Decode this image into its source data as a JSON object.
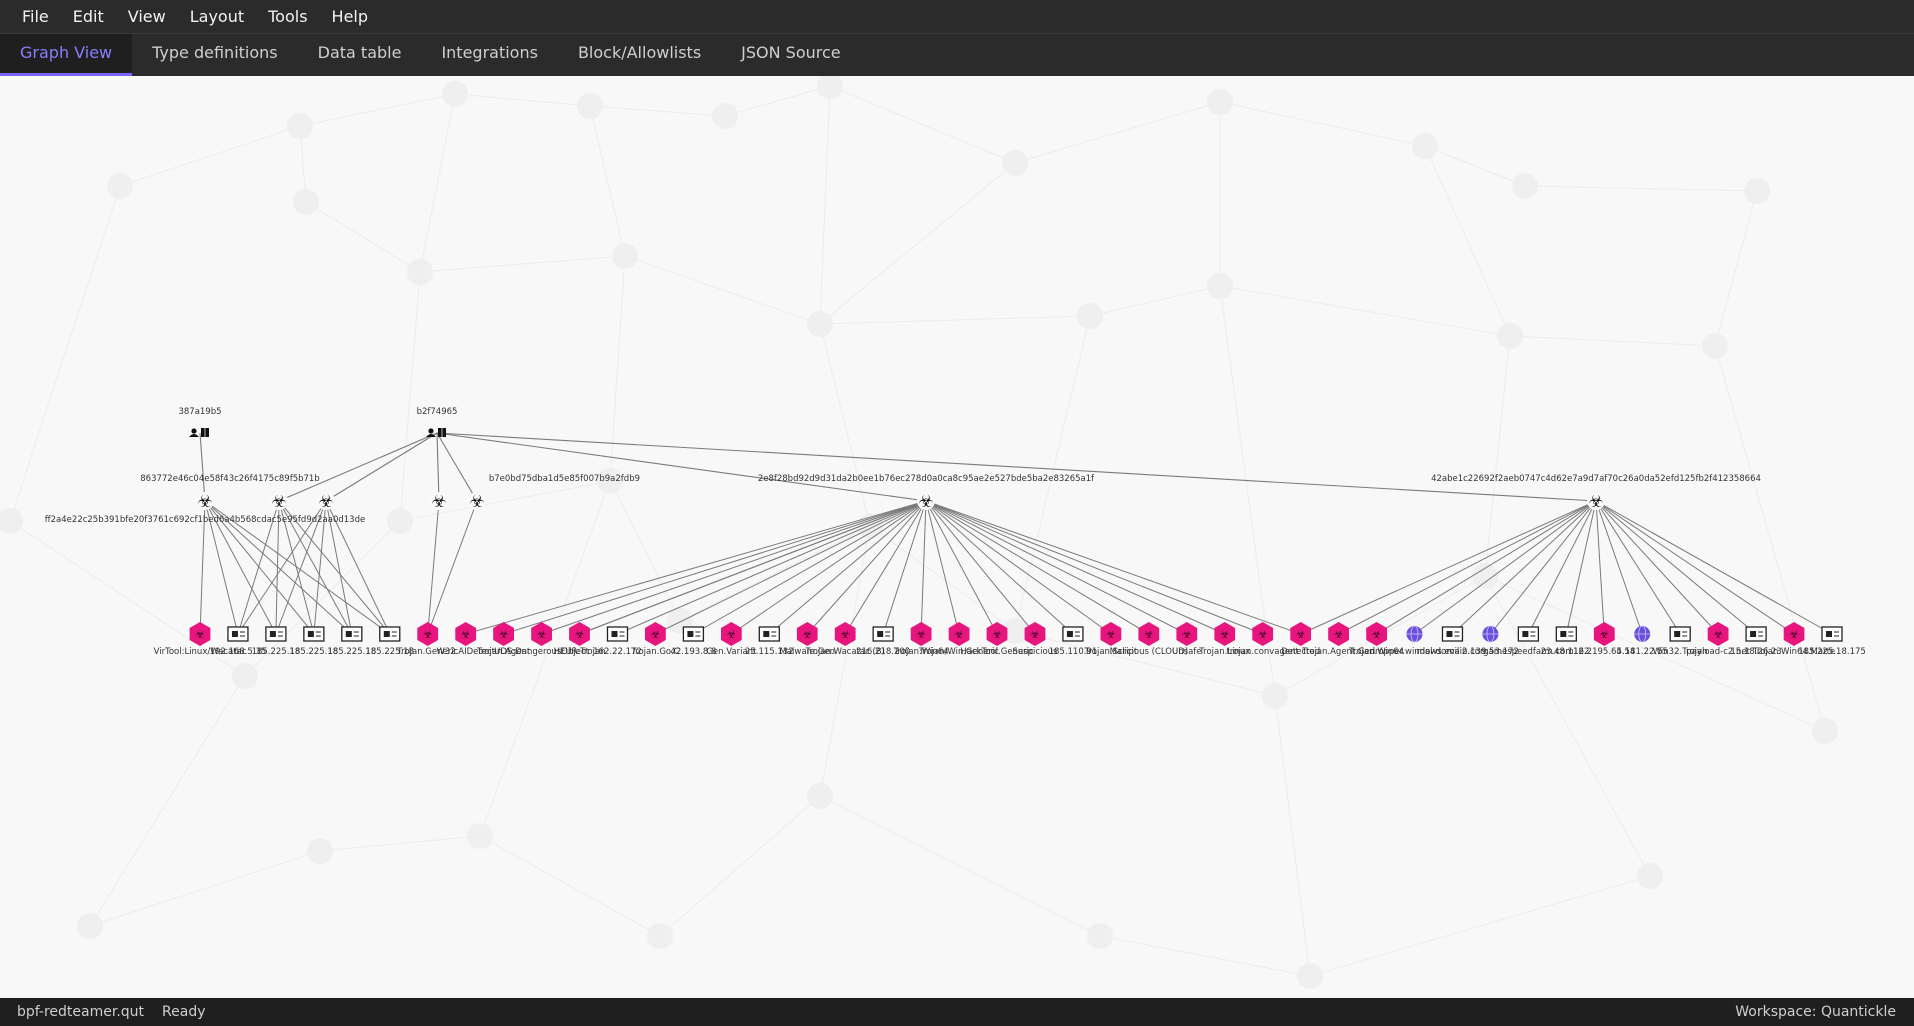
{
  "menu": {
    "items": [
      "File",
      "Edit",
      "View",
      "Layout",
      "Tools",
      "Help"
    ]
  },
  "tabs": [
    {
      "label": "Graph View",
      "active": true
    },
    {
      "label": "Type definitions",
      "active": false
    },
    {
      "label": "Data table",
      "active": false
    },
    {
      "label": "Integrations",
      "active": false
    },
    {
      "label": "Block/Allowlists",
      "active": false
    },
    {
      "label": "JSON Source",
      "active": false
    }
  ],
  "graph": {
    "users": [
      {
        "id": "387a19b5",
        "label": "387a19b5"
      },
      {
        "id": "b2f74965",
        "label": "b2f74965"
      }
    ],
    "hashes": [
      {
        "label": "863772e46c04e58f43c26f4175c89f5b71b"
      },
      {
        "label": "ff2a4e22c25b391bfe20f3761c692cf1bed6a4b568cdac5e95fd9d2aa0d13de"
      },
      {
        "label": "b7e0bd75dba1d5e85f007b9a2fdb9"
      },
      {
        "label": "2e8f28bd92d9d31da2b0ee1b76ec278d0a0ca8c95ae2e527bde5ba2e83265a1f"
      },
      {
        "label": "42abe1c22692f2aeb0747c4d62e7a9d7af70c26a0da52efd125fb2f412358664"
      }
    ],
    "leaf_labels": [
      "VirTool:Linux/Wacatac",
      "192.168.5.35",
      "185.225.18",
      "185.225.18",
      "185.225.18",
      "185.225.18",
      "Trojan.Generic",
      "W32.AIDetect",
      "Trojan.Agent",
      "UDS:DangerousObject",
      "HEUR:Trojan",
      "162.22.172",
      "Trojan.Go.C",
      "42.193.8.8",
      "Gen.Variant",
      "25.115.132",
      "Malware.Gen",
      "Trojan.Wacatac (B)",
      "216.218.200",
      "Trojan:Win64",
      "Trojan/Win.Generic",
      "HackTool.Generic",
      "Suspicious",
      "185.110.91",
      "Trojan.Script",
      "Malicious (CLOUD)",
      "Unsafe",
      "Trojan.Linux",
      "trojan.convagent",
      "Detected",
      "Trojan.Agent.Gen",
      "Trojan.Win64",
      "dropper.windows.evil",
      "mal-domain.com",
      "2.139.53.172",
      "gamespeedfarm.com",
      "23.48.112.2",
      "162.195.64.54",
      "5.181.22.55",
      "Win32.Trojan",
      "payload-c2.net",
      "15.18.26.23",
      "Trojan.Win64.Marte",
      "185.225.18.175"
    ]
  },
  "status": {
    "file": "bpf-redteamer.qut",
    "state": "Ready",
    "workspace": "Workspace: Quanticklе"
  },
  "colors": {
    "accent": "#7866ff",
    "malware_node": "#e6167e",
    "domain_node": "#6a4fd8",
    "edge": "#7a7a7a"
  }
}
